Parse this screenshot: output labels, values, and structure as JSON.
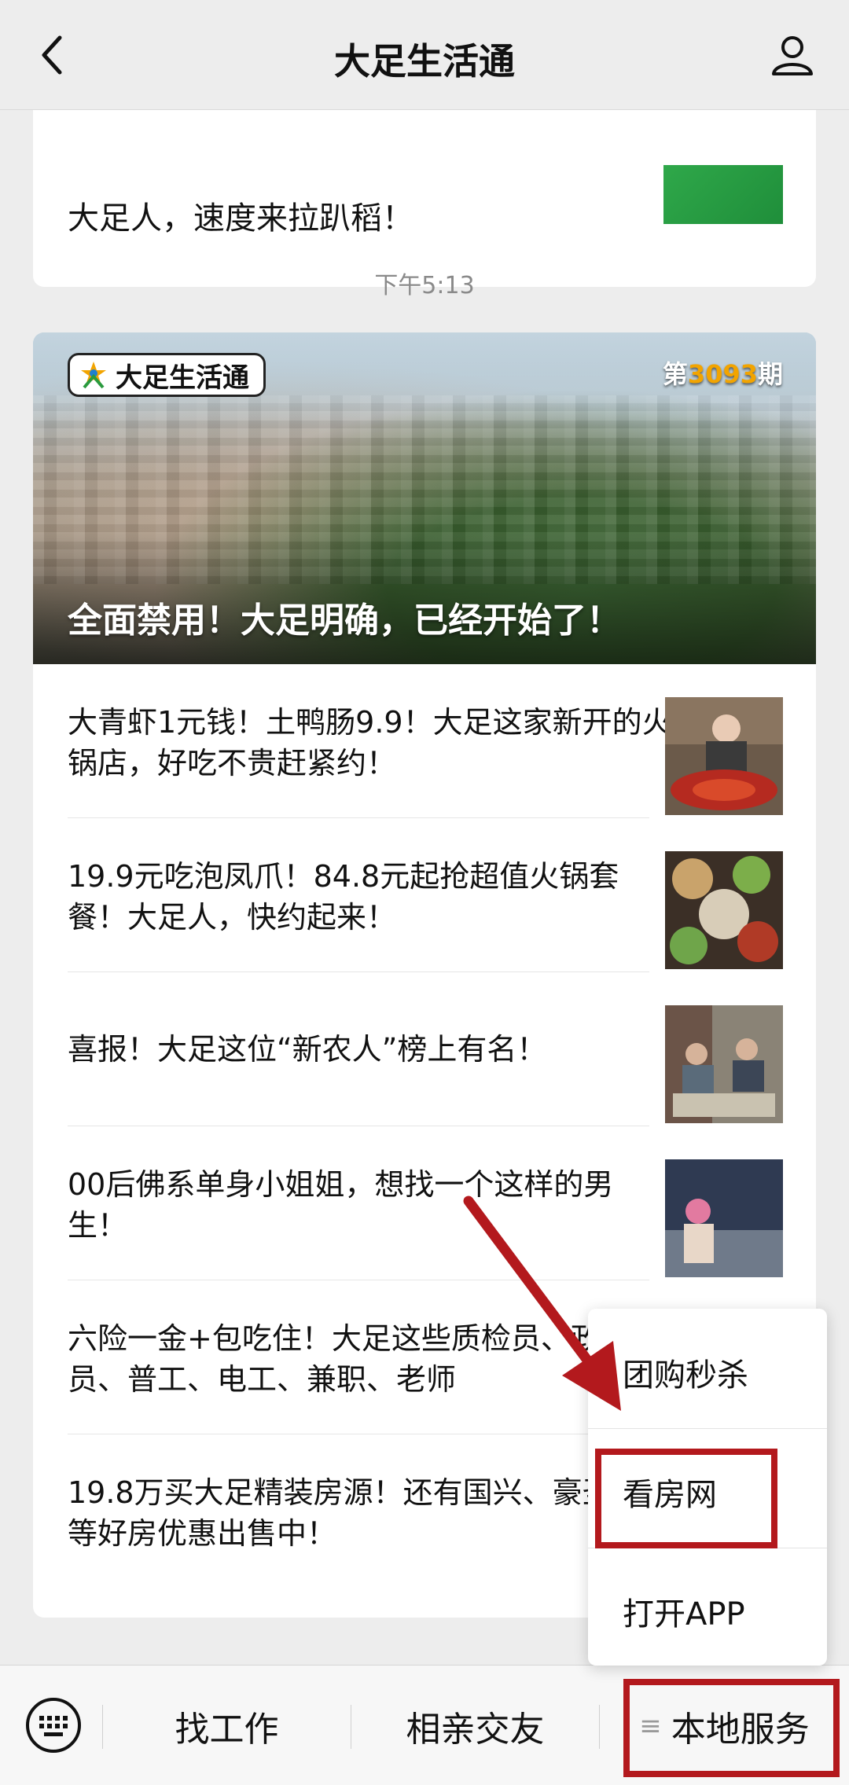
{
  "header": {
    "title": "大足生活通"
  },
  "chat": {
    "prev_card_text": "大足人，速度来拉趴稻！",
    "timestamp": "下午5:13",
    "article": {
      "brand_logo_text": "大足生活通",
      "issue_prefix": "第",
      "issue_number": "3093",
      "issue_suffix": "期",
      "hero_title": "全面禁用！大足明确，已经开始了！",
      "items": [
        {
          "title": "大青虾1元钱！土鸭肠9.9！大足这家新开的火锅店，好吃不贵赶紧约！"
        },
        {
          "title": "19.9元吃泡凤爪！84.8元起抢超值火锅套餐！大足人，快约起来！"
        },
        {
          "title": "喜报！大足这位“新农人”榜上有名！"
        },
        {
          "title": "00后佛系单身小姐姐，想找一个这样的男生！"
        },
        {
          "title": "六险一金+包吃住！大足这些质检员、政专员、普工、电工、兼职、老师"
        },
        {
          "title": "19.8万买大足精装房源！还有国兴、豪圣玺府等好房优惠出售中！"
        }
      ]
    }
  },
  "popup_menu": {
    "items": [
      "团购秒杀",
      "看房网",
      "打开APP"
    ]
  },
  "bottom_bar": {
    "buttons": [
      "找工作",
      "相亲交友",
      "本地服务"
    ]
  },
  "colors": {
    "annotation_red": "#b3191d",
    "issue_number_orange": "#f2a400"
  },
  "icons": [
    "back-arrow-icon",
    "profile-icon",
    "keyboard-icon",
    "menu-lines-icon"
  ]
}
